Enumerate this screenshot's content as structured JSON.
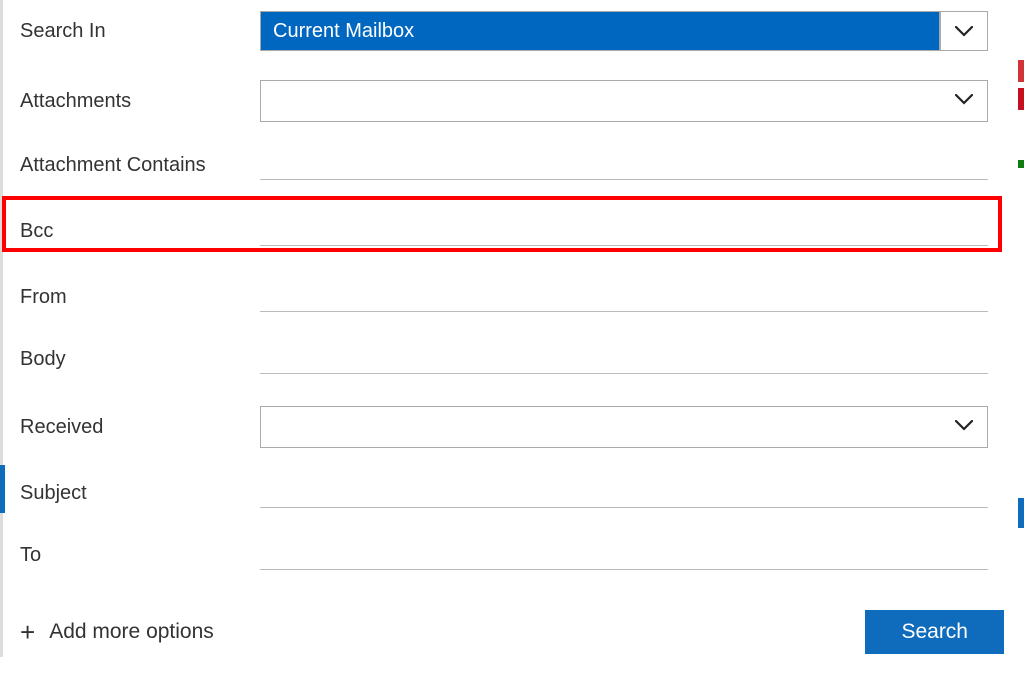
{
  "fields": {
    "search_in": {
      "label": "Search In",
      "value": "Current Mailbox"
    },
    "attachments": {
      "label": "Attachments",
      "value": ""
    },
    "attachment_contains": {
      "label": "Attachment Contains",
      "value": ""
    },
    "bcc": {
      "label": "Bcc",
      "value": ""
    },
    "from": {
      "label": "From",
      "value": ""
    },
    "body": {
      "label": "Body",
      "value": ""
    },
    "received": {
      "label": "Received",
      "value": ""
    },
    "subject": {
      "label": "Subject",
      "value": ""
    },
    "to": {
      "label": "To",
      "value": ""
    }
  },
  "footer": {
    "add_more": "Add more options",
    "search": "Search"
  },
  "colors": {
    "accent": "#0f6cbd",
    "highlight": "#f00"
  }
}
